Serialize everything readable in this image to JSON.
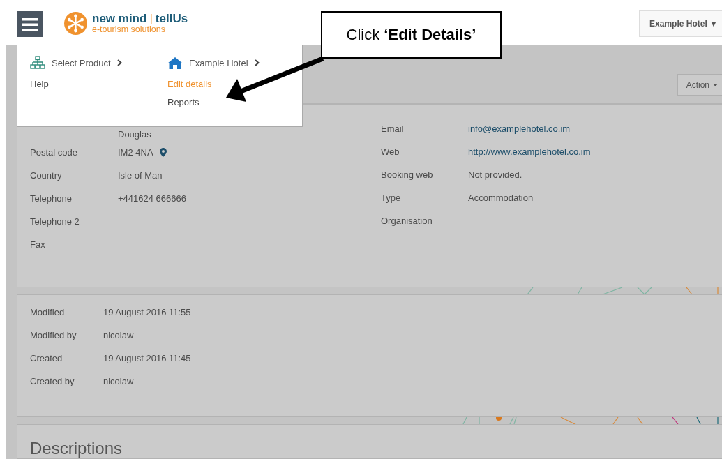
{
  "header": {
    "hotel_button": {
      "label": "Example Hotel",
      "caret": "▼"
    }
  },
  "logo": {
    "brand": "new mind",
    "separator": "|",
    "product": "tellUs",
    "tagline": "e-tourism solutions"
  },
  "menu": {
    "columns": [
      {
        "kind": "products",
        "heading": "Select Product",
        "items": [
          {
            "label": "Help",
            "selected": false
          }
        ]
      },
      {
        "kind": "hotel",
        "heading": "Example Hotel",
        "items": [
          {
            "label": "Edit details",
            "selected": true
          },
          {
            "label": "Reports",
            "selected": false
          }
        ]
      }
    ]
  },
  "toolbar": {
    "action_button": "Action"
  },
  "details": {
    "left": [
      {
        "kind": "text",
        "value": "Douglas"
      },
      {
        "kind": "location",
        "label": "Postal code",
        "value": "IM2 4NA"
      },
      {
        "kind": "text",
        "label": "Country",
        "value": "Isle of Man"
      },
      {
        "kind": "text",
        "label": "Telephone",
        "value": "+441624 666666"
      },
      {
        "kind": "text",
        "label": "Telephone 2"
      },
      {
        "kind": "text",
        "label": "Fax"
      }
    ],
    "right": [
      {
        "kind": "link",
        "label": "Email",
        "value": "info@examplehotel.co.im"
      },
      {
        "kind": "link",
        "label": "Web",
        "value": "http://www.examplehotel.co.im"
      },
      {
        "kind": "text",
        "label": "Booking web",
        "value": "Not provided."
      },
      {
        "kind": "text",
        "label": "Type",
        "value": "Accommodation"
      },
      {
        "label": "Organisation"
      }
    ]
  },
  "audit": [
    {
      "label": "Modified",
      "value": "19 August 2016 11:55"
    },
    {
      "label": "Modified by",
      "value": "nicolaw"
    },
    {
      "label": "Created",
      "value": "19 August 2016 11:45"
    },
    {
      "label": "Created by",
      "value": "nicolaw"
    }
  ],
  "descriptions": {
    "title": "Descriptions"
  },
  "callout": {
    "text": "Click **‘Edit Details’**"
  }
}
